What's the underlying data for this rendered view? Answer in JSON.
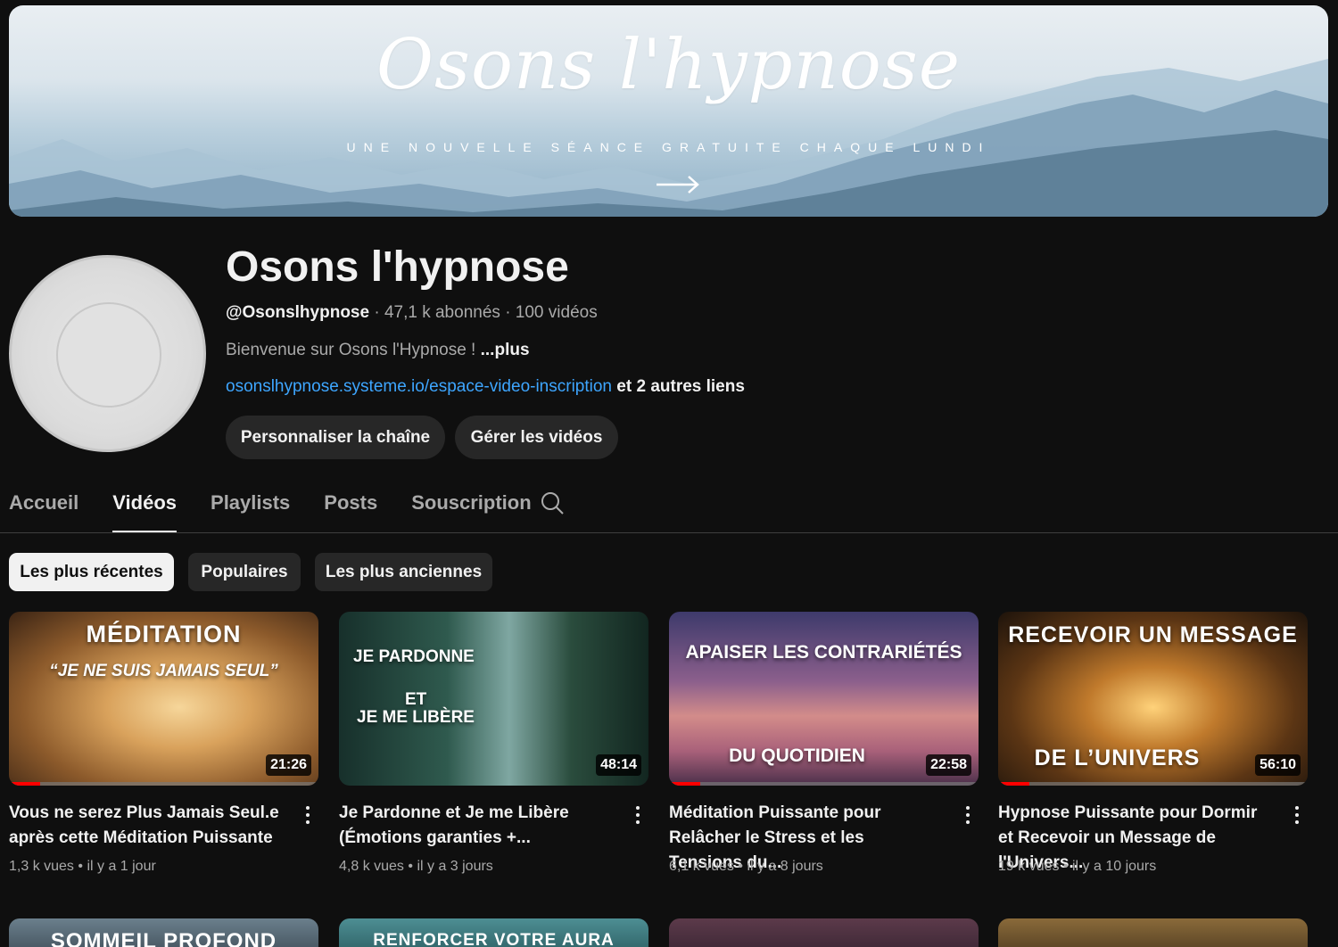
{
  "banner": {
    "title": "Osons l'hypnose",
    "subtitle": "UNE NOUVELLE SÉANCE GRATUITE CHAQUE LUNDI"
  },
  "channel": {
    "name": "Osons l'hypnose",
    "handle": "@Osonslhypnose",
    "subscribers": "47,1 k abonnés",
    "videos_count": "100 vidéos",
    "description": "Bienvenue sur Osons l'Hypnose ! ",
    "description_more": "...plus",
    "link": "osonslhypnose.systeme.io/espace-video-inscription",
    "other_links": " et 2 autres liens",
    "customize_label": "Personnaliser la chaîne",
    "manage_label": "Gérer les vidéos"
  },
  "tabs": [
    {
      "label": "Accueil"
    },
    {
      "label": "Vidéos"
    },
    {
      "label": "Playlists"
    },
    {
      "label": "Posts"
    },
    {
      "label": "Souscription"
    }
  ],
  "chips": [
    {
      "label": "Les plus récentes"
    },
    {
      "label": "Populaires"
    },
    {
      "label": "Les plus anciennes"
    }
  ],
  "videos": [
    {
      "thumb_line1": "MÉDITATION",
      "thumb_line2": "“JE NE SUIS JAMAIS SEUL”",
      "duration": "21:26",
      "watched": 0.1,
      "title": "Vous ne serez Plus Jamais Seul.e après cette Méditation Puissante",
      "views": "1,3 k vues",
      "age": "il y a 1 jour"
    },
    {
      "thumb_line1": "JE PARDONNE",
      "thumb_line2": "ET",
      "thumb_line3": "JE ME LIBÈRE",
      "duration": "48:14",
      "watched": 0,
      "title": "Je Pardonne et Je me Libère (Émotions garanties +...",
      "views": "4,8 k vues",
      "age": "il y a 3 jours"
    },
    {
      "thumb_line1": "APAISER LES CONTRARIÉTÉS",
      "thumb_line2": "DU QUOTIDIEN",
      "duration": "22:58",
      "watched": 0.1,
      "title": "Méditation Puissante pour Relâcher le Stress et les Tensions du...",
      "views": "6,1 k vues",
      "age": "il y a 8 jours"
    },
    {
      "thumb_line1": "RECEVOIR UN MESSAGE",
      "thumb_line2": "DE L’UNIVERS",
      "duration": "56:10",
      "watched": 0.1,
      "title": "Hypnose Puissante pour Dormir et Recevoir un Message de l'Univers...",
      "views": "19 k vues",
      "age": "il y a 10 jours"
    }
  ],
  "row2": [
    {
      "thumb_line1": "SOMMEIL PROFOND"
    },
    {
      "thumb_line1": "RENFORCER VOTRE AURA"
    },
    {
      "thumb_line1": ""
    },
    {
      "thumb_line1": ""
    }
  ],
  "colors": {
    "background": "#0f0f0f",
    "link": "#3ea6ff",
    "progress": "#ff0000",
    "chip_active": "#f1f1f1"
  }
}
